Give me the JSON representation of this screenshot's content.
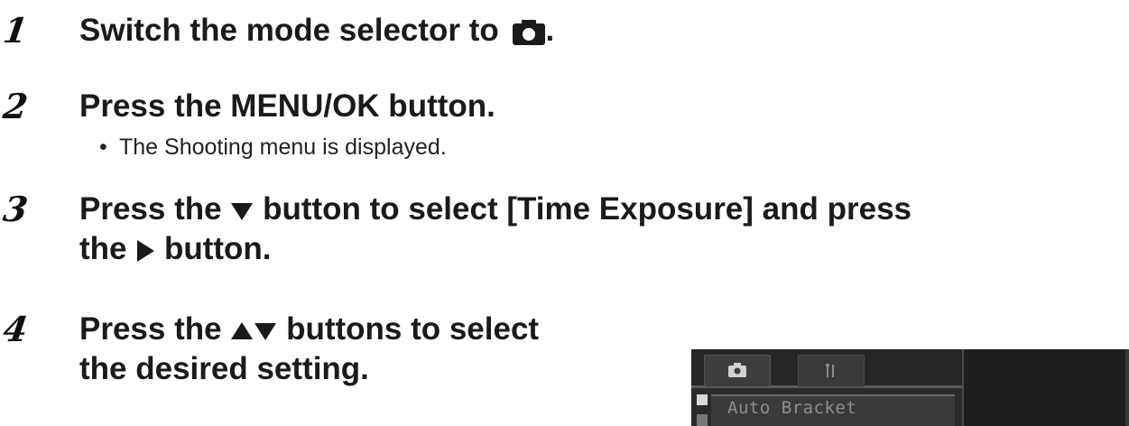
{
  "steps": [
    {
      "number": "1",
      "text_before": "Switch the mode selector to",
      "text_after": ".",
      "icon": "camera-icon"
    },
    {
      "number": "2",
      "text": "Press the MENU/OK button.",
      "sub": "The Shooting menu is displayed."
    },
    {
      "number": "3",
      "line1_a": "Press the",
      "line1_b": "button to select [Time Exposure] and press",
      "line2_a": "the",
      "line2_b": "button.",
      "icons": [
        "down-triangle-icon",
        "right-triangle-icon"
      ]
    },
    {
      "number": "4",
      "line1_a": "Press the",
      "line1_b": "buttons to select",
      "line2": "the desired setting.",
      "icons": [
        "up-triangle-icon",
        "down-triangle-icon"
      ]
    }
  ],
  "menu_screen": {
    "tab1_icon": "camera-icon",
    "tab2_icon": "wrench-icon",
    "visible_item": "Auto Bracket"
  },
  "colors": {
    "text": "#1a1a1a",
    "lcd_bg": "#2b2b2b"
  }
}
